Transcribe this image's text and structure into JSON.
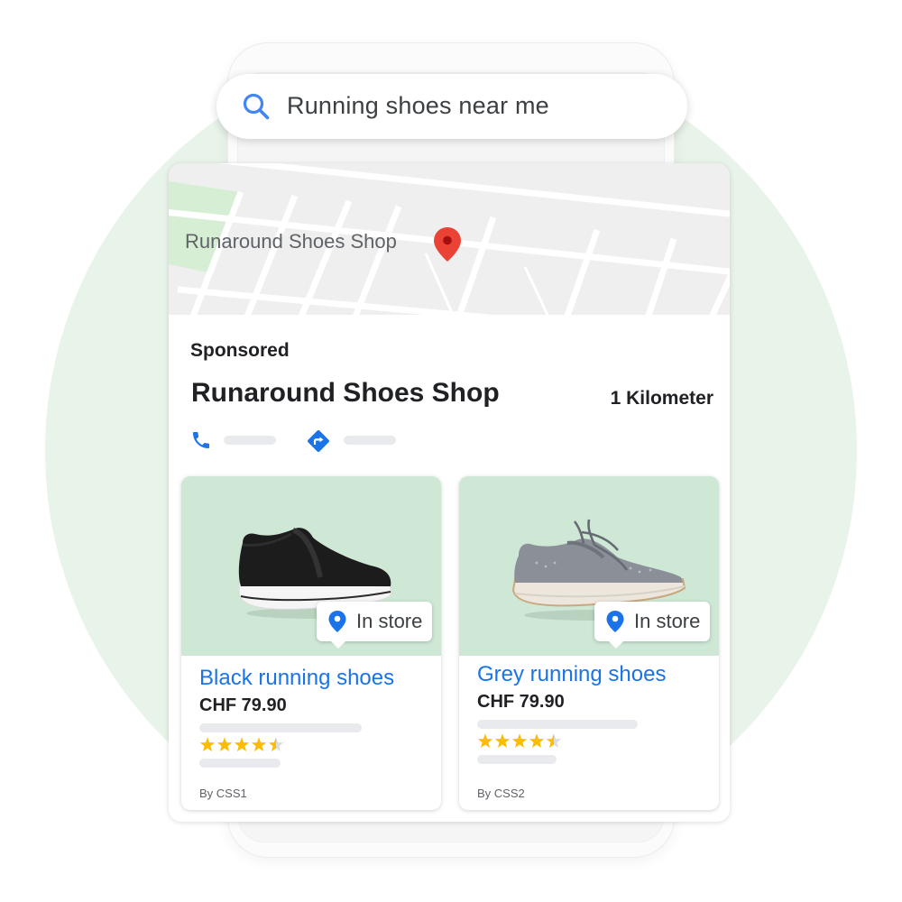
{
  "search": {
    "query": "Running shoes near me"
  },
  "map": {
    "label": "Runaround Shoes Shop"
  },
  "listing": {
    "sponsored": "Sponsored",
    "shop_name": "Runaround Shoes Shop",
    "distance": "1 Kilometer"
  },
  "products": [
    {
      "title": "Black running shoes",
      "price": "CHF 79.90",
      "badge": "In store",
      "rating": 4.5,
      "by": "By CSS1",
      "icon": "black-shoe-image"
    },
    {
      "title": "Grey running shoes",
      "price": "CHF 79.90",
      "badge": "In store",
      "rating": 4.5,
      "by": "By CSS2",
      "icon": "grey-shoe-image"
    }
  ],
  "colors": {
    "accent": "#1a73e8",
    "pin_red": "#ea4335",
    "star": "#fbbc04",
    "product_bg": "#cfe8d6",
    "background_circle": "#e8f3e9"
  }
}
